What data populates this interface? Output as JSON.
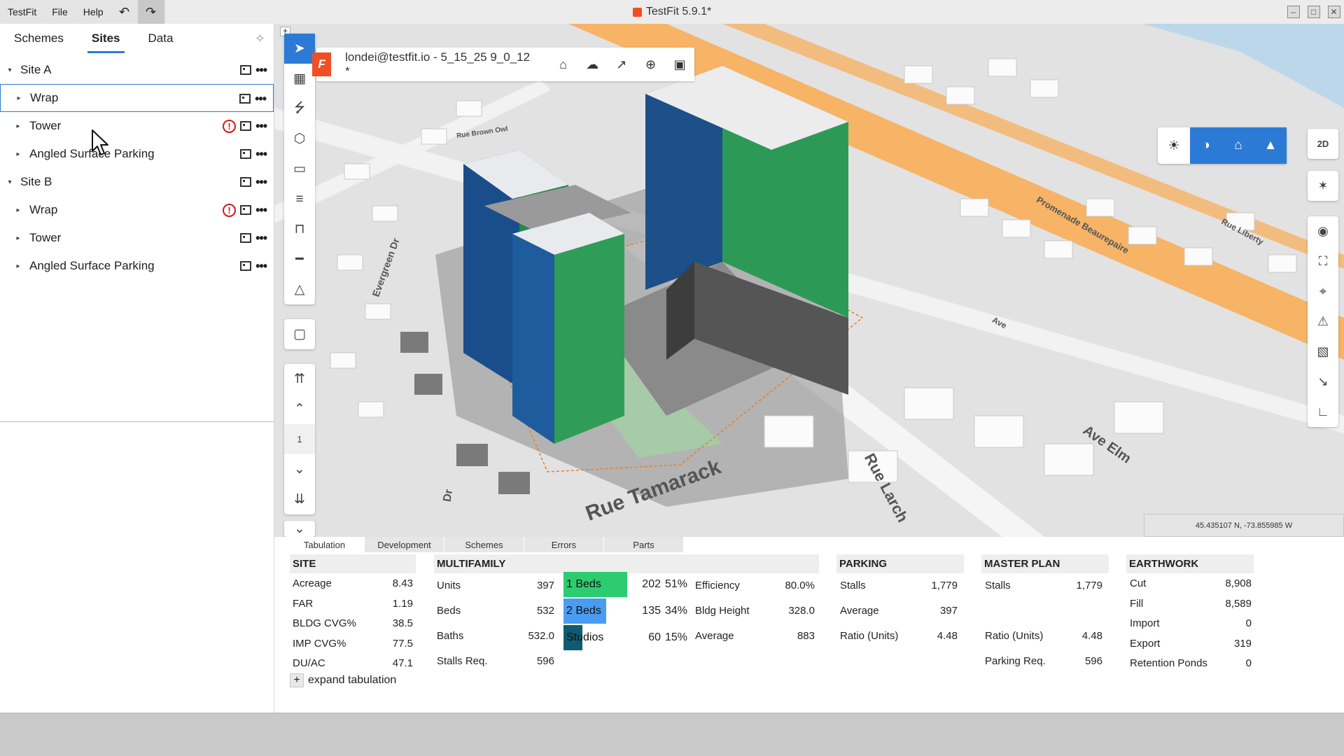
{
  "titlebar": {
    "menu": [
      "TestFit",
      "File",
      "Help"
    ],
    "app_title": "TestFit 5.9.1*"
  },
  "left_panel": {
    "tabs": [
      "Schemes",
      "Sites",
      "Data"
    ],
    "active_tab": "Sites",
    "sites": [
      {
        "name": "Site A",
        "items": [
          {
            "name": "Wrap",
            "warning": false,
            "selected": true
          },
          {
            "name": "Tower",
            "warning": true
          },
          {
            "name": "Angled Surface Parking",
            "warning": false
          }
        ]
      },
      {
        "name": "Site B",
        "items": [
          {
            "name": "Wrap",
            "warning": true
          },
          {
            "name": "Tower",
            "warning": false
          },
          {
            "name": "Angled Surface Parking",
            "warning": false
          }
        ]
      }
    ]
  },
  "viewport": {
    "project_name": "londei@testfit.io - 5_15_25 9_0_12 *",
    "page_number": "1",
    "mode_label": "2D",
    "coords": "45.435107 N, -73.855985 W",
    "streets": [
      "Rue Tamarack",
      "Rue Larch",
      "Ave Elm",
      "Evergreen Dr",
      "Promenade Beaurepaire",
      "Rue Brown Owl",
      "Rue Liberty",
      "Ave",
      "Dr"
    ]
  },
  "bottom": {
    "tabs": [
      "Tabulation",
      "Development",
      "Schemes",
      "Errors",
      "Parts"
    ],
    "active_tab": "Tabulation",
    "site": {
      "title": "SITE",
      "rows": [
        [
          "Acreage",
          "8.43"
        ],
        [
          "FAR",
          "1.19"
        ],
        [
          "BLDG CVG%",
          "38.5"
        ],
        [
          "IMP CVG%",
          "77.5"
        ],
        [
          "DU/AC",
          "47.1"
        ]
      ]
    },
    "multifamily": {
      "title": "MULTIFAMILY",
      "rows": [
        [
          "Units",
          "397"
        ],
        [
          "Beds",
          "532"
        ],
        [
          "Baths",
          "532.0"
        ],
        [
          "Stalls Req.",
          "596"
        ]
      ],
      "mix": [
        {
          "label": "1 Beds",
          "count": "202",
          "pct": "51%",
          "color": "#2ecc71",
          "fraction": 0.51
        },
        {
          "label": "2 Beds",
          "count": "135",
          "pct": "34%",
          "color": "#4a9cf0",
          "fraction": 0.34
        },
        {
          "label": "Studios",
          "count": "60",
          "pct": "15%",
          "color": "#0f5b73",
          "fraction": 0.15
        }
      ],
      "stats": [
        [
          "Efficiency",
          "80.0%"
        ],
        [
          "Bldg Height",
          "328.0"
        ],
        [
          "Average",
          "883"
        ]
      ]
    },
    "parking": {
      "title": "PARKING",
      "rows": [
        [
          "Stalls",
          "1,779"
        ],
        [
          "Average",
          "397"
        ],
        [
          "Ratio (Units)",
          "4.48"
        ]
      ]
    },
    "master_plan": {
      "title": "MASTER PLAN",
      "rows": [
        [
          "Stalls",
          "1,779"
        ],
        [
          "Ratio (Units)",
          "4.48"
        ],
        [
          "Parking Req.",
          "596"
        ]
      ]
    },
    "earthwork": {
      "title": "EARTHWORK",
      "rows": [
        [
          "Cut",
          "8,908"
        ],
        [
          "Fill",
          "8,589"
        ],
        [
          "Import",
          "0"
        ],
        [
          "Export",
          "319"
        ],
        [
          "Retention Ponds",
          "0"
        ]
      ]
    },
    "expand_label": "expand tabulation"
  }
}
